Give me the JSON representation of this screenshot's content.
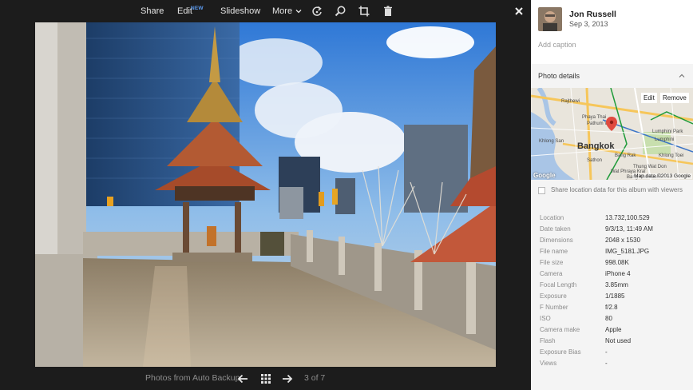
{
  "toolbar": {
    "share_label": "Share",
    "edit_label": "Edit",
    "edit_badge": "NEW",
    "slideshow_label": "Slideshow",
    "more_label": "More",
    "icons": [
      "rotate-icon",
      "zoom-icon",
      "crop-icon",
      "delete-icon",
      "close-icon"
    ]
  },
  "bottom_bar": {
    "album_name": "Photos from Auto Backup",
    "counter": "3 of 7",
    "icons": [
      "prev-arrow-icon",
      "grid-icon",
      "next-arrow-icon"
    ]
  },
  "owner": {
    "name": "Jon Russell",
    "date": "Sep 3, 2013",
    "caption_placeholder": "Add caption"
  },
  "details": {
    "title": "Photo details",
    "map": {
      "edit_label": "Edit",
      "remove_label": "Remove",
      "city_label": "Bangkok",
      "labels": [
        "Rajthewi",
        "Phaya Thai",
        "Pathum Wan",
        "Khlong San",
        "Lumphini Park",
        "Bang Rak",
        "Sathon",
        "Khlong Toei",
        "Thung Wat Don",
        "Lumphini",
        "Wat Phraya Krai",
        "Bang Kho Laem"
      ],
      "attribution": "Map data ©2013 Google",
      "logo": "Google"
    },
    "share_location_label": "Share location data for this album with viewers",
    "properties": [
      {
        "key": "Location",
        "value": "13.732,100.529"
      },
      {
        "key": "Date taken",
        "value": "9/3/13, 11:49 AM"
      },
      {
        "key": "Dimensions",
        "value": "2048 x 1530"
      },
      {
        "key": "File name",
        "value": "IMG_5181.JPG"
      },
      {
        "key": "File size",
        "value": "998.08K"
      },
      {
        "key": "Camera",
        "value": "iPhone 4"
      },
      {
        "key": "Focal Length",
        "value": "3.85mm"
      },
      {
        "key": "Exposure",
        "value": "1/1885"
      },
      {
        "key": "F Number",
        "value": "f/2.8"
      },
      {
        "key": "ISO",
        "value": "80"
      },
      {
        "key": "Camera make",
        "value": "Apple"
      },
      {
        "key": "Flash",
        "value": "Not used"
      },
      {
        "key": "Exposure Bias",
        "value": "-"
      },
      {
        "key": "Views",
        "value": "-"
      }
    ]
  },
  "colors": {
    "viewer_bg": "#1c1c1c",
    "panel_bg": "#f4f4f4",
    "badge_blue": "#5b9bf0"
  }
}
